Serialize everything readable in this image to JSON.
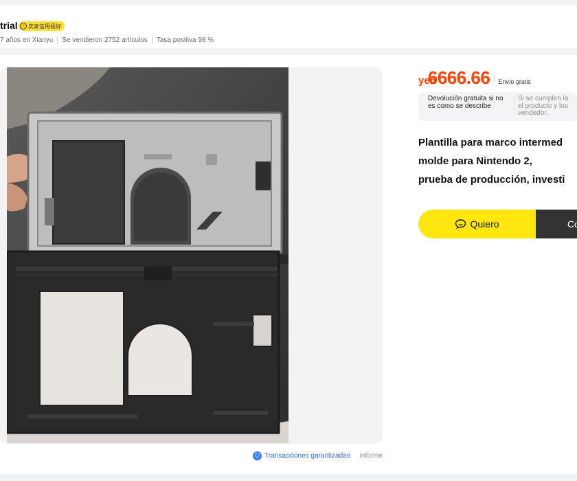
{
  "seller": {
    "name_fragment": "trial",
    "badge_text": "卖家信用极好",
    "badge_icon": "smiley-icon",
    "stats": [
      "7 años en Xianyu",
      "Se vendieron 2752 artículos",
      "Tasa positiva 98 %"
    ]
  },
  "product": {
    "currency": "yen",
    "price": "6666.66",
    "shipping": "Envío gratis",
    "promise_1": "Devolución gratuita si no es como se describe",
    "promise_2": [
      "Si se cumplen la",
      "el producto y los",
      "vendedor."
    ],
    "title_lines": [
      "Plantilla para marco intermed",
      "molde para Nintendo 2,",
      "prueba de producción, investi"
    ]
  },
  "actions": {
    "want_label": "Quiero",
    "buy_label": "Co"
  },
  "footer": {
    "guarantee": "Transacciones garantizadas",
    "report": "informe"
  },
  "colors": {
    "price": "#ff4400",
    "want_button": "#ffe60f",
    "buy_button": "#333333",
    "badge": "#ffe033",
    "link": "#2f6fe0"
  }
}
